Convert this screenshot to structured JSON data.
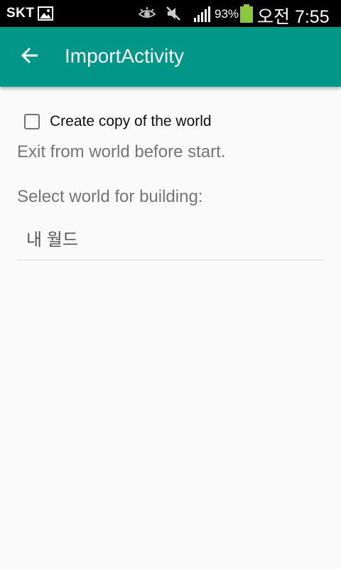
{
  "status_bar": {
    "carrier": "SKT",
    "battery_percent": "93%",
    "clock": "오전 7:55",
    "icons": [
      "gallery-icon",
      "eye-icon",
      "mute-icon",
      "signal-icon",
      "battery-icon"
    ]
  },
  "app_bar": {
    "title": "ImportActivity",
    "back_icon": "arrow-left-icon",
    "color": "#009688"
  },
  "form": {
    "copy_checkbox": {
      "label": "Create copy of the world",
      "checked": false
    },
    "hint": "Exit from world before start.",
    "select_label": "Select world for building:",
    "world_select": {
      "selected": "내 월드"
    }
  }
}
